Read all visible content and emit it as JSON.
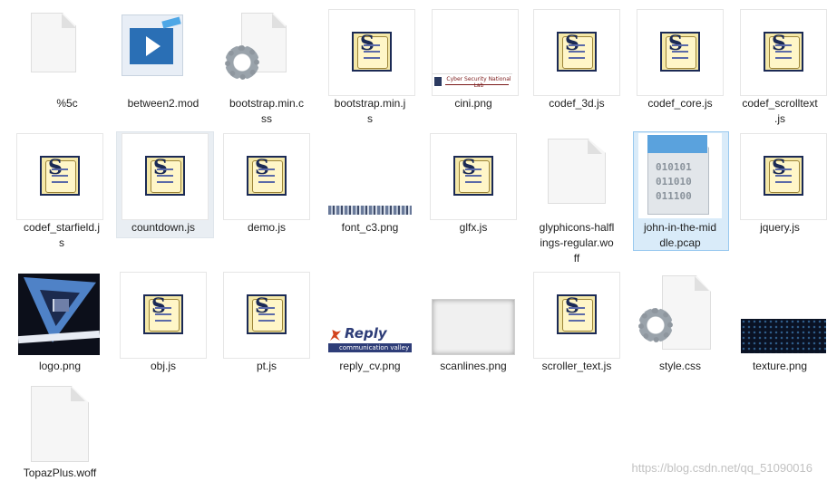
{
  "files": [
    {
      "name": "%5c"
    },
    {
      "name": "between2.mod"
    },
    {
      "name": "bootstrap.min.css"
    },
    {
      "name": "bootstrap.min.js"
    },
    {
      "name": "cini.png"
    },
    {
      "name": "codef_3d.js"
    },
    {
      "name": "codef_core.js"
    },
    {
      "name": "codef_scrolltext.js"
    },
    {
      "name": "codef_starfield.js"
    },
    {
      "name": "countdown.js"
    },
    {
      "name": "demo.js"
    },
    {
      "name": "font_c3.png"
    },
    {
      "name": "glfx.js"
    },
    {
      "name": "glyphicons-halflings-regular.woff"
    },
    {
      "name": "john-in-the-middle.pcap"
    },
    {
      "name": "jquery.js"
    },
    {
      "name": "logo.png"
    },
    {
      "name": "obj.js"
    },
    {
      "name": "pt.js"
    },
    {
      "name": "reply_cv.png"
    },
    {
      "name": "scanlines.png"
    },
    {
      "name": "scroller_text.js"
    },
    {
      "name": "style.css"
    },
    {
      "name": "texture.png"
    },
    {
      "name": "TopazPlus.woff"
    }
  ],
  "labels_wrapped": {
    "bootstrap_min_css": [
      "bootstrap.min.c",
      "ss"
    ],
    "bootstrap_min_js": [
      "bootstrap.min.j",
      "s"
    ],
    "codef_scrolltext": [
      "codef_scrolltext",
      ".js"
    ],
    "codef_starfield": [
      "codef_starfield.j",
      "s"
    ],
    "glyphicons": [
      "glyphicons-halfl",
      "ings-regular.wo",
      "ff"
    ],
    "john": [
      "john-in-the-mid",
      "dle.pcap"
    ]
  },
  "thumb_text": {
    "cini_logo": "Cyber Security National Lab",
    "reply_brand": "Reply",
    "reply_sub": "communication valley",
    "pcap_bits": [
      "010101",
      "011010",
      "011100"
    ]
  },
  "watermark": "https://blog.csdn.net/qq_51090016",
  "colors": {
    "selection_bg": "#d9ebf9",
    "selection_border": "#99c9ef",
    "hover_bg": "#e9eef3",
    "script_navy": "#1b2a55",
    "script_yellow": "#f4e8a8"
  }
}
